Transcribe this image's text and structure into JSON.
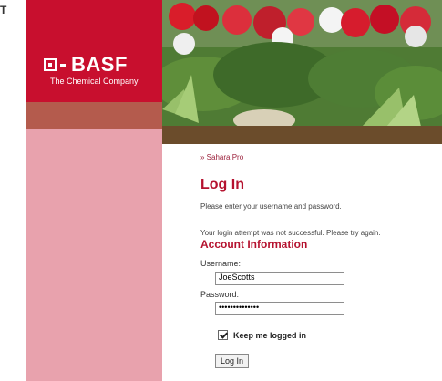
{
  "brand": {
    "corner_mark": "T",
    "logo_text": "BASF",
    "tagline": "The Chemical Company"
  },
  "breadcrumb": "» Sahara Pro",
  "login": {
    "title": "Log In",
    "intro": "Please enter your username and password.",
    "error": "Your login attempt was not successful. Please try again.",
    "section_title": "Account Information",
    "username_label": "Username:",
    "username_value": "JoeScotts",
    "password_label": "Password:",
    "password_masked": "••••••••••••••",
    "remember_label": "Keep me logged in",
    "button_label": "Log In"
  },
  "colors": {
    "brand_red": "#c80f2e",
    "sidebar_pink": "#e8a2ad",
    "title_red": "#b5122f"
  }
}
